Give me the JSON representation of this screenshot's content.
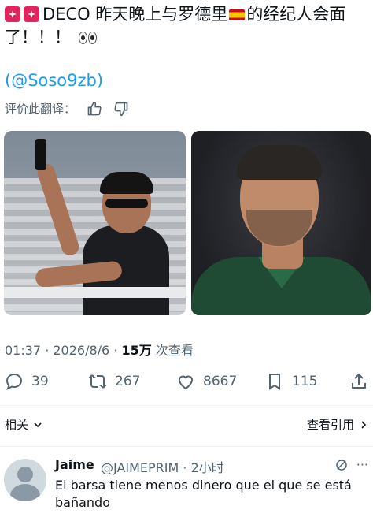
{
  "tweet": {
    "text_main": "DECO 昨天晚上与罗德里",
    "text_tail": "的经纪人会面了！！！",
    "mention": "(@Soso9zb)",
    "translate_label": "评价此翻译："
  },
  "meta": {
    "time": "01:37",
    "date": "2026/8/6",
    "sep": " · ",
    "views_count": "15万",
    "views_label": " 次查看"
  },
  "actions": {
    "replies": "39",
    "retweets": "267",
    "likes": "8667",
    "bookmarks": "115"
  },
  "links": {
    "related": "相关",
    "quotes": "查看引用"
  },
  "reply": {
    "name": "Jaime",
    "handle": "@JAIMEPRIM · 2小时",
    "text": "El barsa tiene menos dinero que el que se está bañando",
    "more": "···"
  },
  "colors": {
    "accent": "#1d9bf0",
    "muted": "#536471"
  },
  "icons": [
    "flag-icon",
    "spain-flag-icon",
    "eyes-icon",
    "thumbs-up-icon",
    "thumbs-down-icon",
    "reply-icon",
    "retweet-icon",
    "like-icon",
    "bookmark-icon",
    "share-icon",
    "chevron-down-icon",
    "chevron-right-icon",
    "hide-icon"
  ]
}
